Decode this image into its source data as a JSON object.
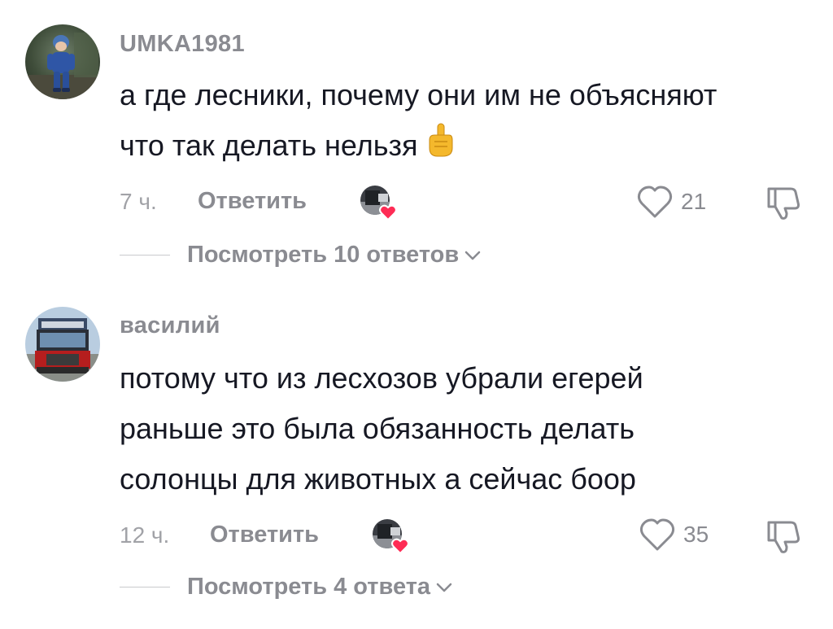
{
  "comments": [
    {
      "username": "UMKA1981",
      "lines": [
        "а где лесники, почему они им не объясняют",
        "что так делать нельзя"
      ],
      "emoji": "☝",
      "time": "7 ч.",
      "reply_label": "Ответить",
      "likes": "21",
      "view_replies": "Посмотреть 10 ответов"
    },
    {
      "username": "василий",
      "lines": [
        "потому что из лесхозов убрали егерей",
        "раньше это была обязанность делать",
        "солонцы для животных а сейчас боор"
      ],
      "time": "12 ч.",
      "reply_label": "Ответить",
      "likes": "35",
      "view_replies": "Посмотреть 4 ответа"
    }
  ],
  "colors": {
    "heart_badge": "#fe2c55",
    "muted_text": "#8a8b91",
    "body_text": "#161823"
  },
  "icons": [
    "heart-outline-icon",
    "dislike-icon",
    "chevron-down-icon",
    "creator-liked-heart-icon"
  ]
}
